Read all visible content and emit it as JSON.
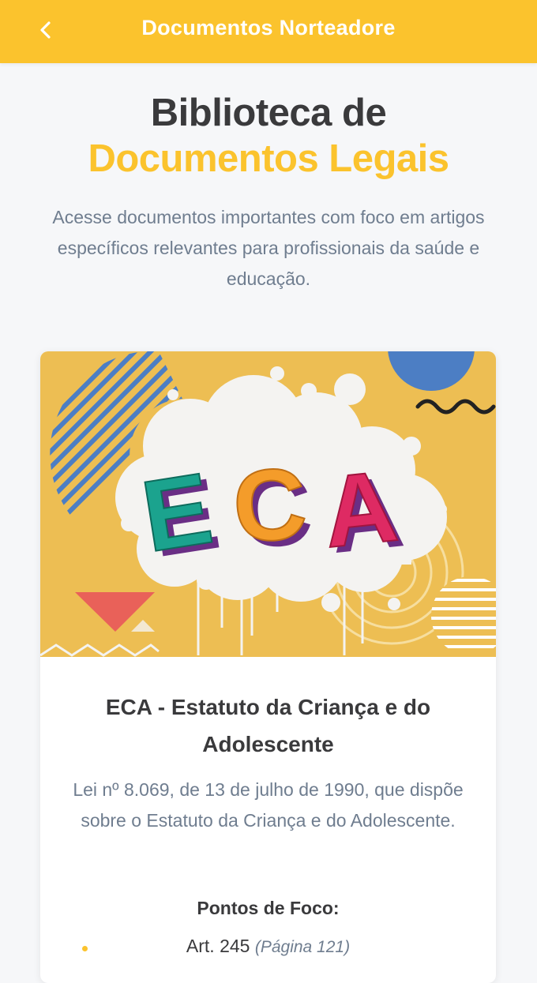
{
  "appbar": {
    "title": "Documentos Norteadore",
    "back_icon": "chevron-left-icon",
    "color": "#fbc32d"
  },
  "hero": {
    "title_line1": "Biblioteca de",
    "title_line2": "Documentos Legais",
    "subtitle": "Acesse documentos importantes com foco em artigos específicos relevantes para profissionais da saúde e educação."
  },
  "documents": [
    {
      "image_text": "ECA",
      "title": "ECA - Estatuto da Criança e do Adolescente",
      "description": "Lei nº 8.069, de 13 de julho de 1990, que dispõe sobre o Estatuto da Criança e do Adolescente.",
      "focus_heading": "Pontos de Foco:",
      "focus_points": [
        {
          "article": "Art. 245",
          "page": "(Página 121)"
        }
      ]
    }
  ]
}
